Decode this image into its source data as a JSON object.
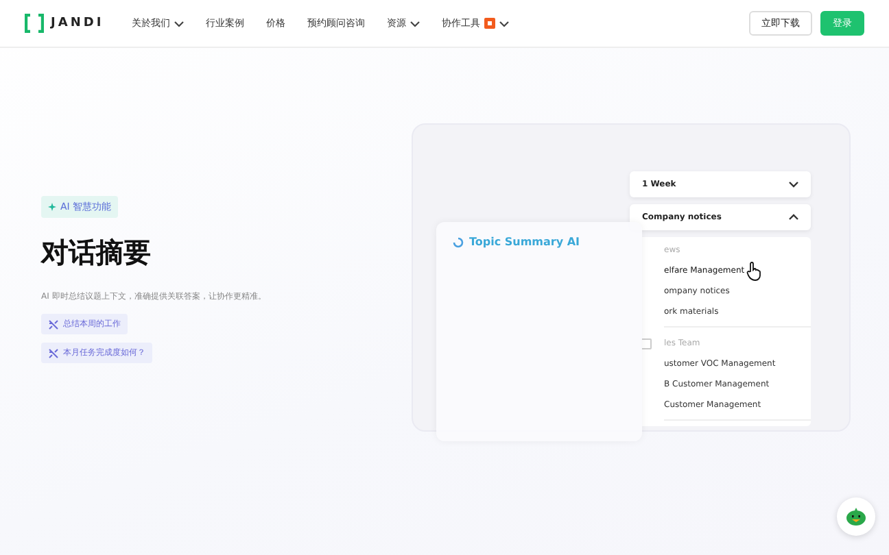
{
  "nav": {
    "logo": "JANDI",
    "items": [
      {
        "label": "关於我们",
        "dropdown": true,
        "badge": false
      },
      {
        "label": "行业案例",
        "dropdown": false,
        "badge": false
      },
      {
        "label": "价格",
        "dropdown": false,
        "badge": false
      },
      {
        "label": "预约顾问咨询",
        "dropdown": false,
        "badge": false
      },
      {
        "label": "资源",
        "dropdown": true,
        "badge": false
      },
      {
        "label": "协作工具",
        "dropdown": true,
        "badge": true
      }
    ],
    "download": "立即下载",
    "login": "登录"
  },
  "hero": {
    "tag": "AI 智慧功能",
    "title": "对话摘要",
    "description": "AI 即时总结议题上下文，准确提供关联答案，让协作更精准。",
    "prompts": [
      "总结本周的工作",
      "本月任务完成度如何？"
    ]
  },
  "demo": {
    "period": "1 Week",
    "channel": "Company notices",
    "channel_open": true,
    "panel_title": "Topic Summary AI",
    "groups": [
      {
        "name": "ews",
        "checkbox": false,
        "items": [
          {
            "label": "elfare Management",
            "hovered": true
          },
          {
            "label": "ompany notices",
            "hovered": false
          },
          {
            "label": "ork materials",
            "hovered": false
          }
        ]
      },
      {
        "name": "les Team",
        "checkbox": true,
        "items": [
          {
            "label": "ustomer VOC Management",
            "hovered": false
          },
          {
            "label": "B Customer Management",
            "hovered": false
          },
          {
            "label": "Customer Management",
            "hovered": false
          }
        ]
      }
    ]
  }
}
